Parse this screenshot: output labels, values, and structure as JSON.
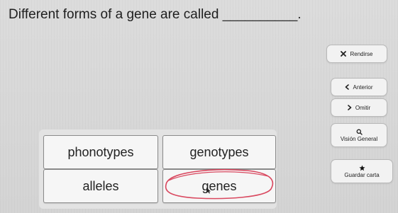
{
  "question": {
    "text": "Different forms of a gene are called",
    "blank": "__________."
  },
  "answers": [
    {
      "label": "phonotypes"
    },
    {
      "label": "genotypes"
    },
    {
      "label": "alleles"
    },
    {
      "label": "genes"
    }
  ],
  "selected_answer": "genes",
  "sidebar": {
    "rendirse": {
      "label": "Rendirse",
      "icon": "x-icon"
    },
    "anterior": {
      "label": "Anterior",
      "icon": "chevron-left-icon"
    },
    "omitir": {
      "label": "Omitir",
      "icon": "chevron-right-icon"
    },
    "vision_general": {
      "label": "Visión General",
      "icon": "search-icon"
    },
    "guardar_carta": {
      "label": "Guardar carta",
      "icon": "star-icon"
    }
  },
  "colors": {
    "selection_circle": "#d9485f",
    "background": "#d8d8d8"
  }
}
